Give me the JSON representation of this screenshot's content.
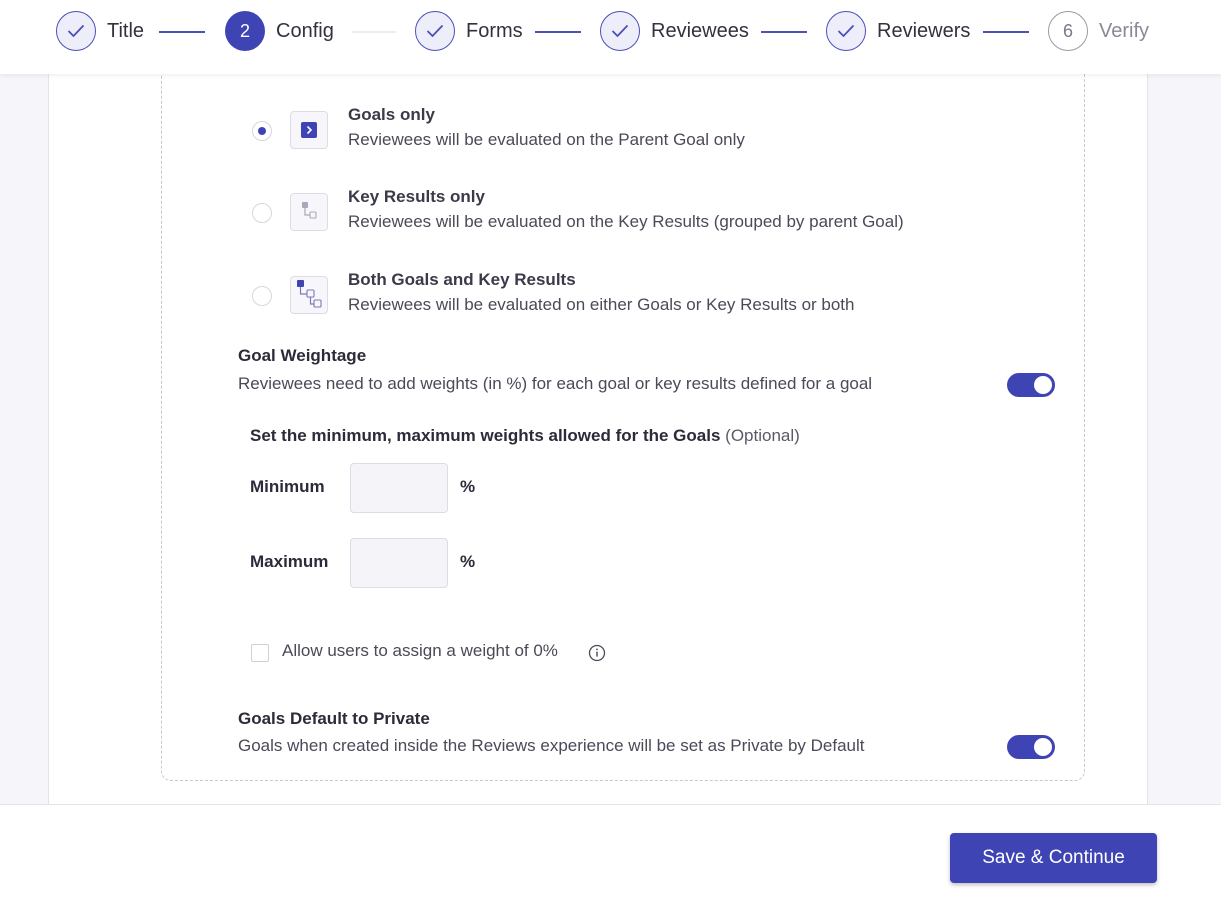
{
  "stepper": {
    "steps": [
      {
        "number": "",
        "label": "Title",
        "state": "done"
      },
      {
        "number": "2",
        "label": "Config",
        "state": "active"
      },
      {
        "number": "",
        "label": "Forms",
        "state": "done"
      },
      {
        "number": "",
        "label": "Reviewees",
        "state": "done"
      },
      {
        "number": "",
        "label": "Reviewers",
        "state": "done"
      },
      {
        "number": "6",
        "label": "Verify",
        "state": "todo"
      }
    ]
  },
  "evaluation_type": {
    "options": [
      {
        "title": "Goals only",
        "description": "Reviewees will be evaluated on the Parent Goal only",
        "selected": true,
        "icon": "goal-icon"
      },
      {
        "title": "Key Results only",
        "description": "Reviewees will be evaluated on the Key Results (grouped by parent Goal)",
        "selected": false,
        "icon": "key-results-icon"
      },
      {
        "title": "Both Goals and Key Results",
        "description": "Reviewees will be evaluated on either Goals or Key Results or both",
        "selected": false,
        "icon": "goals-and-key-results-icon"
      }
    ]
  },
  "goal_weightage": {
    "title": "Goal Weightage",
    "description": "Reviewees need to add weights (in %) for each goal or key results defined for a goal",
    "enabled": true,
    "range_title": "Set the minimum, maximum weights allowed for the Goals",
    "range_optional": "(Optional)",
    "minimum_label": "Minimum",
    "minimum_value": "",
    "maximum_label": "Maximum",
    "maximum_value": "",
    "percent_symbol": "%",
    "allow_zero_label": "Allow users to assign a weight of 0%",
    "allow_zero_checked": false
  },
  "goals_private": {
    "title": "Goals Default to Private",
    "description": "Goals when created inside the Reviews experience will be set as Private by Default",
    "enabled": true
  },
  "footer": {
    "save_label": "Save & Continue"
  },
  "colors": {
    "accent": "#3f44b5",
    "background": "#f6f6fa"
  }
}
